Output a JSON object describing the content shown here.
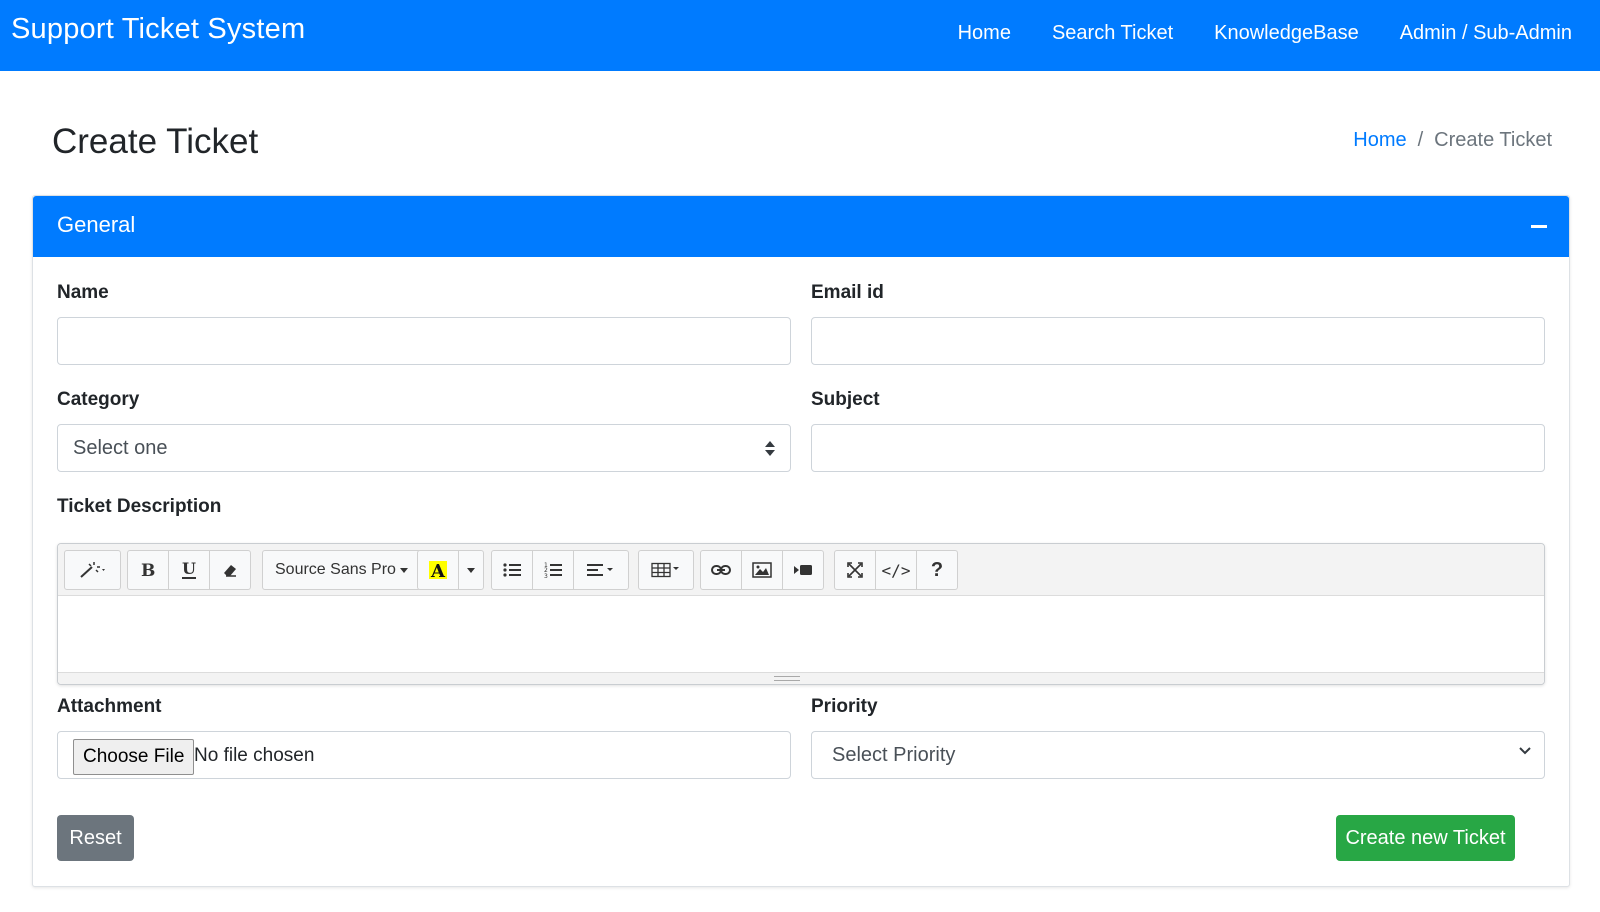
{
  "navbar": {
    "brand": "Support Ticket System",
    "links": [
      "Home",
      "Search Ticket",
      "KnowledgeBase",
      "Admin / Sub-Admin"
    ],
    "color": "#007bff"
  },
  "page": {
    "title": "Create Ticket",
    "breadcrumb": {
      "home": "Home",
      "separator": "/",
      "current": "Create Ticket"
    }
  },
  "card": {
    "title": "General",
    "collapse_icon": "minus-icon"
  },
  "form": {
    "name_label": "Name",
    "name_value": "",
    "email_label": "Email id",
    "email_value": "",
    "category_label": "Category",
    "category_selected": "Select one",
    "subject_label": "Subject",
    "subject_value": "",
    "description_label": "Ticket Description",
    "editor": {
      "font_name": "Source Sans Pro",
      "toolbar_icons": [
        "magic-icon",
        "bold-icon",
        "underline-icon",
        "eraser-icon",
        "font-name-dropdown",
        "text-color-icon",
        "color-dropdown-icon",
        "unordered-list-icon",
        "ordered-list-icon",
        "align-icon",
        "table-icon",
        "link-icon",
        "picture-icon",
        "video-icon",
        "fullscreen-icon",
        "code-view-icon",
        "help-icon"
      ],
      "help_label": "?",
      "code_label": "</>"
    },
    "attachment_label": "Attachment",
    "file_button": "Choose File",
    "file_status": "No file chosen",
    "priority_label": "Priority",
    "priority_selected": "Select Priority",
    "reset_button": "Reset",
    "submit_button": "Create new Ticket"
  },
  "colors": {
    "primary": "#007bff",
    "secondary": "#6c757d",
    "success": "#28a745"
  }
}
